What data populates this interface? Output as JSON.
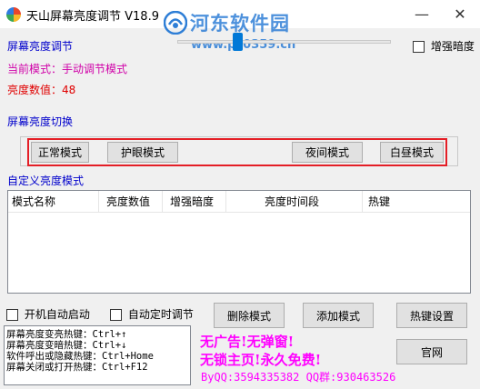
{
  "window": {
    "title": "天山屏幕亮度调节 V18.9",
    "minimize_glyph": "—",
    "close_glyph": "✕"
  },
  "watermark": {
    "title": "河东软件园",
    "url": "www.pc0359.cn"
  },
  "brightness": {
    "label": "屏幕亮度调节",
    "current_mode": "当前模式：手动调节模式",
    "value_text": "亮度数值：48",
    "level": 48,
    "enhance_dark_label": "增强暗度",
    "enhance_dark_checked": false
  },
  "switch": {
    "label": "屏幕亮度切换",
    "modes": [
      "正常模式",
      "护眼模式",
      "夜间模式",
      "白昼模式"
    ]
  },
  "custom": {
    "label": "自定义亮度模式",
    "columns": [
      "模式名称",
      "亮度数值",
      "增强暗度",
      "亮度时间段",
      "热键"
    ],
    "rows": []
  },
  "options": {
    "autostart_label": "开机自动启动",
    "autostart_checked": false,
    "timed_label": "自动定时调节",
    "timed_checked": false
  },
  "actions": {
    "delete_label": "删除模式",
    "add_label": "添加模式",
    "hotkey_settings_label": "热键设置",
    "website_label": "官网"
  },
  "hotkeys": [
    "屏幕亮度变亮热键：Ctrl+↑",
    "屏幕亮度变暗热键：Ctrl+↓",
    "软件呼出或隐藏热键：Ctrl+Home",
    "屏幕关闭或打开热键：Ctrl+F12"
  ],
  "promo": {
    "line1": "无广告!无弹窗!",
    "line2": "无锁主页!永久免费!",
    "contact": "ByQQ:3594335382 QQ群:930463526"
  },
  "colors": {
    "accent": "#0078d7",
    "label_blue": "#0000cc",
    "mode_magenta": "#d000a8",
    "value_red": "#e00000",
    "highlight_frame": "#e41e26",
    "promo": "#ff00ff"
  }
}
